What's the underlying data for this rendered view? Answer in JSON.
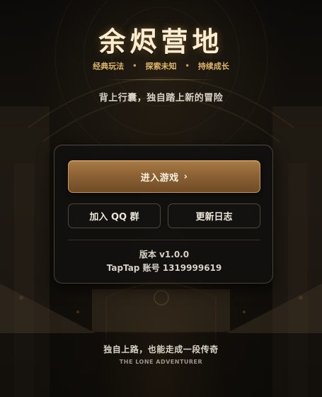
{
  "header": {
    "title": "余烬营地",
    "tags": [
      "经典玩法",
      "探索未知",
      "持续成长"
    ],
    "tag_separator": "•",
    "tagline": "背上行囊，独自踏上新的冒险"
  },
  "menu": {
    "enter_game_label": "进入游戏",
    "enter_game_chevron": "›",
    "join_qq_label": "加入 QQ 群",
    "changelog_label": "更新日志",
    "version_text": "版本 v1.0.0",
    "account_text": "TapTap 账号 1319999619"
  },
  "footer": {
    "line": "独自上路，也能走成一段传奇",
    "subline": "THE LONE ADVENTURER"
  },
  "colors": {
    "accent_gold": "#e0b76a",
    "button_bronze": "#8d6335",
    "title": "#fbeed2"
  },
  "icons": {
    "enter_chevron": "chevron-right-icon"
  }
}
